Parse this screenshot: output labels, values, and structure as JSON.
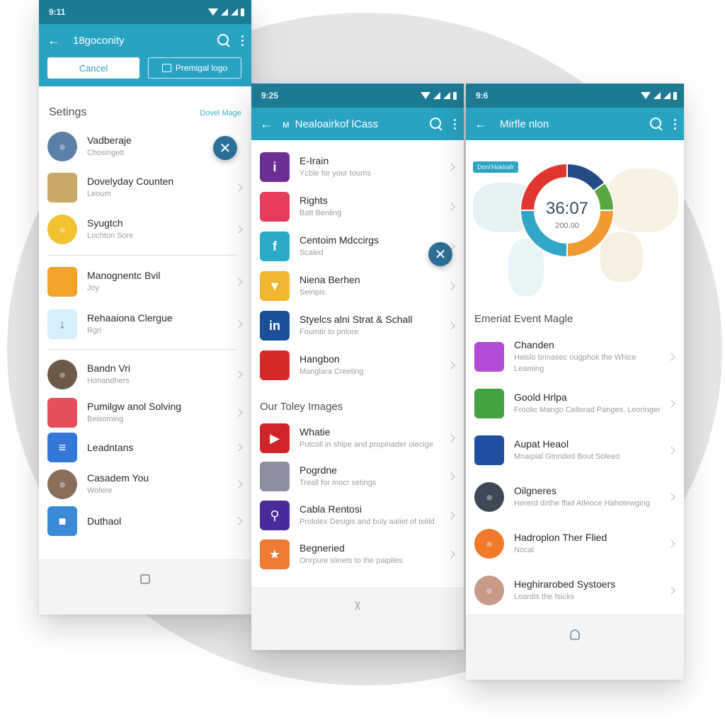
{
  "screens": [
    {
      "status_time": "9:11",
      "title": "18goconity",
      "buttons": {
        "cancel": "Cancel",
        "primary": "Premigal logo"
      },
      "section": {
        "title": "Setings",
        "link": "Dovel Mage"
      },
      "items": [
        {
          "name": "Vadberaje",
          "sub": "Chosingetl",
          "icon": "person-avatar",
          "color": "#5b7fa6"
        },
        {
          "name": "Dovelyday Counten",
          "sub": "Leoum",
          "icon": "landscape-photo",
          "color": "#c9a968"
        },
        {
          "name": "Syugtch",
          "sub": "Lochton Sore",
          "icon": "person-avatar",
          "color": "#f2c230"
        },
        {
          "name": "Manognentc Bvil",
          "sub": "Joy",
          "icon": "bag-icon",
          "color": "#f0a52a"
        },
        {
          "name": "Rehaaiona Clergue",
          "sub": "Rgri",
          "icon": "download-icon",
          "color": "#d8eef8"
        },
        {
          "name": "Bandn Vri",
          "sub": "Honandhers",
          "icon": "person-avatar",
          "color": "#6b5a4a"
        },
        {
          "name": "Pumilgw anol Solving",
          "sub": "Beisoming",
          "icon": "palette-icon",
          "color": "#e54e5a"
        },
        {
          "name": "Leadntans",
          "sub": "",
          "icon": "document-icon",
          "color": "#3378d8"
        },
        {
          "name": "Casadem You",
          "sub": "Wofere",
          "icon": "person-avatar",
          "color": "#8a6e5c"
        },
        {
          "name": "Duthaol",
          "sub": "",
          "icon": "chat-icon",
          "color": "#3a8ad6"
        }
      ],
      "nav_icon": "square-icon"
    },
    {
      "status_time": "9:25",
      "title": "Nealoairkof lCass",
      "items": [
        {
          "name": "E-Irain",
          "sub": "Ycble for your toums",
          "icon": "info-icon",
          "color": "#6b2f93"
        },
        {
          "name": "Rights",
          "sub": "Batt Benling",
          "icon": "hand-icon",
          "color": "#e63c5c"
        },
        {
          "name": "Centoim Mdccirgs",
          "sub": "Scaled",
          "icon": "facebook-icon",
          "color": "#2aa9c9"
        },
        {
          "name": "Niena Berhen",
          "sub": "Seinpis",
          "icon": "lightbulb-icon",
          "color": "#f2b731"
        },
        {
          "name": "Styelcs alni Strat & Schall",
          "sub": "Foumtir to pnlore",
          "icon": "linkedin-icon",
          "color": "#1b4f96"
        },
        {
          "name": "Hangbon",
          "sub": "Manglara Creeting",
          "icon": "pattern-icon",
          "color": "#d52a2a"
        }
      ],
      "section_title": "Our Toley Images",
      "items2": [
        {
          "name": "Whatie",
          "sub": "Putcoll in shipe and propinader oiecige",
          "icon": "youtube-icon",
          "color": "#d0232a"
        },
        {
          "name": "Pogrdne",
          "sub": "Treall for mocr setings",
          "icon": "glasses-icon",
          "color": "#8c8ea0"
        },
        {
          "name": "Cabla Rentosi",
          "sub": "Prololex Desigis and buly aaliet of telild",
          "icon": "key-icon",
          "color": "#4b2b9a"
        },
        {
          "name": "Begneried",
          "sub": "Onrpure siinets to the paipiles.",
          "icon": "star-icon",
          "color": "#ef7a32"
        }
      ],
      "nav_icon": "hanger-icon"
    },
    {
      "status_time": "9:6",
      "title": "Mirfle nlon",
      "tag": "Donl'Hoklrafr",
      "donut": {
        "main": "36:07",
        "sub": "200.00"
      },
      "section_title": "Emeriat Event Magle",
      "items": [
        {
          "name": "Chanden",
          "sub": "Helslo brinasec ougphok the Whice Leaming",
          "icon": "petals-icon",
          "color": "#b44bd6"
        },
        {
          "name": "Goold Hrlpa",
          "sub": "Froolic Mango Cellorad Panges. Leoringer",
          "icon": "creature-icon",
          "color": "#43a33e"
        },
        {
          "name": "Aupat Heaol",
          "sub": "Mnaipial Gtnnded Bout Soleed",
          "icon": "wave-icon",
          "color": "#1f4f9e"
        },
        {
          "name": "Oilgneres",
          "sub": "Hererd dirthe ffad Atleoce Hahotewging",
          "icon": "person-avatar",
          "color": "#3d4a55"
        },
        {
          "name": "Hadroplon Ther Flied",
          "sub": "Nocal",
          "icon": "person-avatar",
          "color": "#f07a2a"
        },
        {
          "name": "Heghirarobed Systoers",
          "sub": "Loardis the fsicks",
          "icon": "person-avatar",
          "color": "#c89a88"
        }
      ],
      "nav_icon": "robot-icon"
    }
  ],
  "chart_data": {
    "type": "pie",
    "title": "36:07",
    "subtitle": "200.00",
    "categories": [
      "Red",
      "Navy",
      "Green",
      "Orange",
      "Blue"
    ],
    "values": [
      25,
      15,
      10,
      25,
      25
    ],
    "colors": [
      "#e0362f",
      "#244b86",
      "#5aa640",
      "#f19a33",
      "#32a6c8"
    ]
  }
}
